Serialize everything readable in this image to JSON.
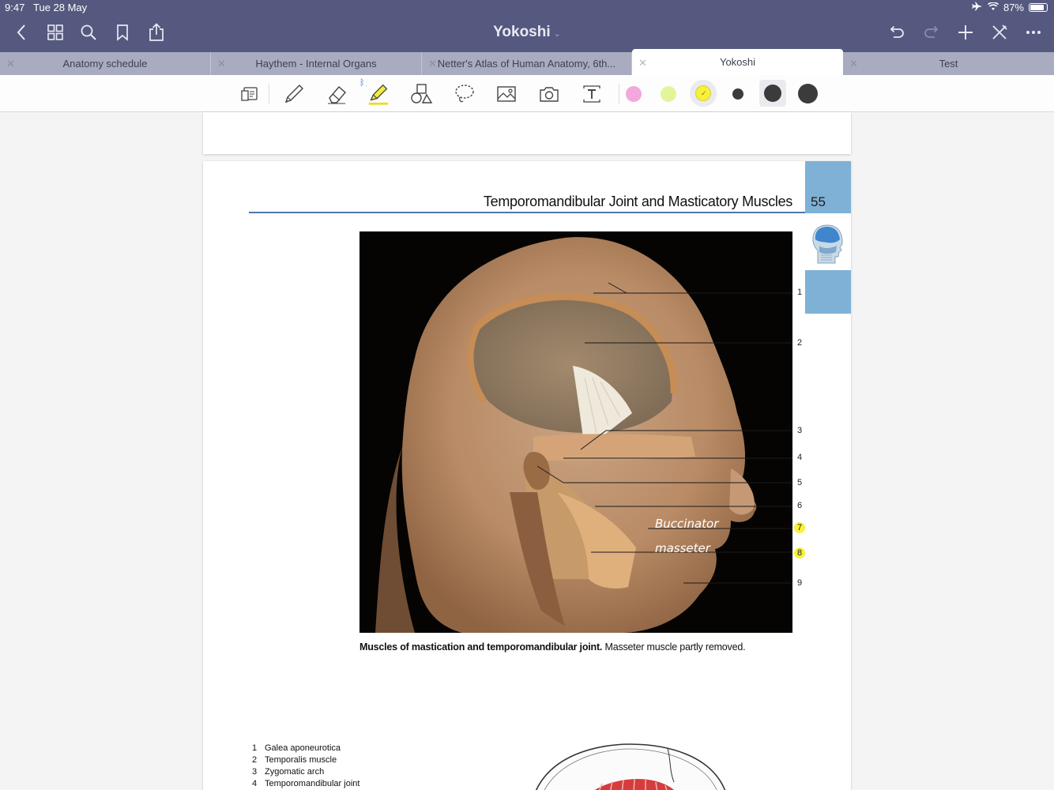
{
  "status": {
    "time": "9:47",
    "date": "Tue 28 May",
    "battery": "87%",
    "battery_level": 0.87
  },
  "nav": {
    "title": "Yokoshi",
    "icons": [
      "back-icon",
      "grid-icon",
      "search-icon",
      "bookmark-icon",
      "share-icon",
      "undo-icon",
      "redo-icon",
      "add-icon",
      "pen-off-icon",
      "more-icon"
    ]
  },
  "tabs": [
    {
      "label": "Anatomy schedule"
    },
    {
      "label": "Haythem - Internal Organs"
    },
    {
      "label": "Netter's Atlas of Human Anatomy, 6th..."
    },
    {
      "label": "Yokoshi",
      "active": true
    },
    {
      "label": "Test"
    }
  ],
  "tools": [
    "page-view-icon",
    "pen-icon",
    "eraser-icon",
    "highlighter-icon",
    "shapes-icon",
    "lasso-icon",
    "image-icon",
    "camera-icon",
    "text-icon"
  ],
  "colors": {
    "pink": "#f2a8dd",
    "lime": "#e2f59a",
    "yellow": "#f7f03e",
    "dark": "#3b3b3b",
    "appbar": "#55597f",
    "tabbar": "#a9abc0",
    "accent_blue": "#7fb1d6"
  },
  "page": {
    "chapter_title": "Temporomandibular Joint and Masticatory Muscles",
    "page_number": "55",
    "figure_labels": [
      "1",
      "2",
      "3",
      "4",
      "5",
      "6",
      "7",
      "8",
      "9"
    ],
    "highlighted_labels": [
      "7",
      "8"
    ],
    "handwritten": [
      "Buccinator",
      "masseter"
    ],
    "caption_bold": "Muscles of mastication and temporomandibular joint.",
    "caption_rest": " Masseter muscle partly removed.",
    "legend": [
      {
        "n": "1",
        "text": "Galea aponeurotica"
      },
      {
        "n": "2",
        "text": "Temporalis muscle"
      },
      {
        "n": "3",
        "text": "Zygomatic arch"
      },
      {
        "n": "4",
        "text": "Temporomandibular joint"
      }
    ]
  }
}
